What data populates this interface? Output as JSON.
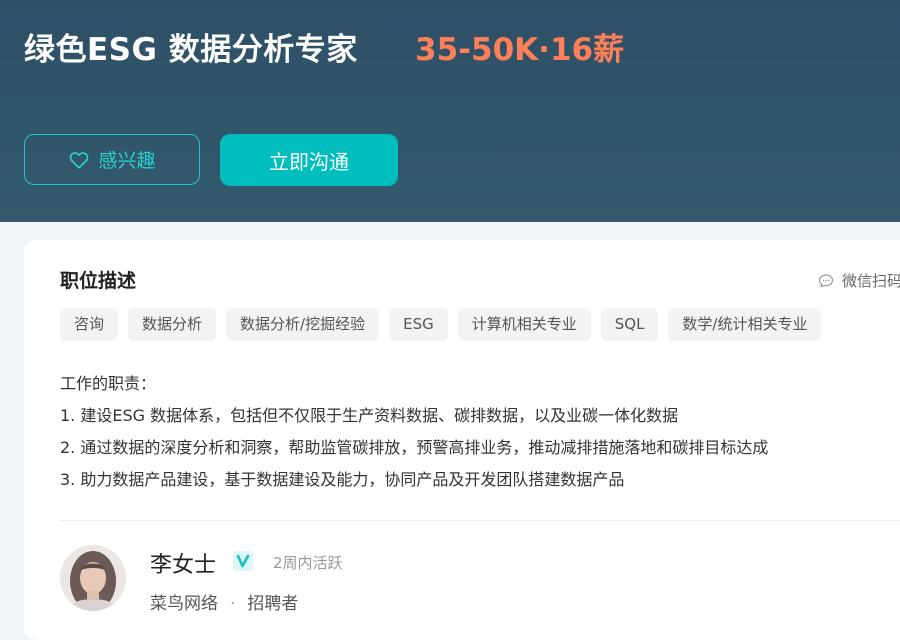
{
  "job": {
    "title": "绿色ESG 数据分析专家",
    "salary": "35-50K·16薪"
  },
  "actions": {
    "interest_label": "感兴趣",
    "chat_label": "立即沟通"
  },
  "description": {
    "section_title": "职位描述",
    "wechat_label": "微信扫码",
    "tags": [
      "咨询",
      "数据分析",
      "数据分析/挖掘经验",
      "ESG",
      "计算机相关专业",
      "SQL",
      "数学/统计相关专业"
    ],
    "lines": [
      "工作的职责：",
      "1. 建设ESG 数据体系，包括但不仅限于生产资料数据、碳排数据，以及业碳一体化数据",
      "2. 通过数据的深度分析和洞察，帮助监管碳排放，预警高排业务，推动减排措施落地和碳排目标达成",
      "3. 助力数据产品建设，基于数据建设及能力，协同产品及开发团队搭建数据产品"
    ]
  },
  "recruiter": {
    "name": "李女士",
    "active_status": "2周内活跃",
    "company": "菜鸟网络",
    "role": "招聘者"
  },
  "colors": {
    "accent": "#00bebd",
    "salary": "#ff7f58",
    "header": "#2f5569"
  }
}
